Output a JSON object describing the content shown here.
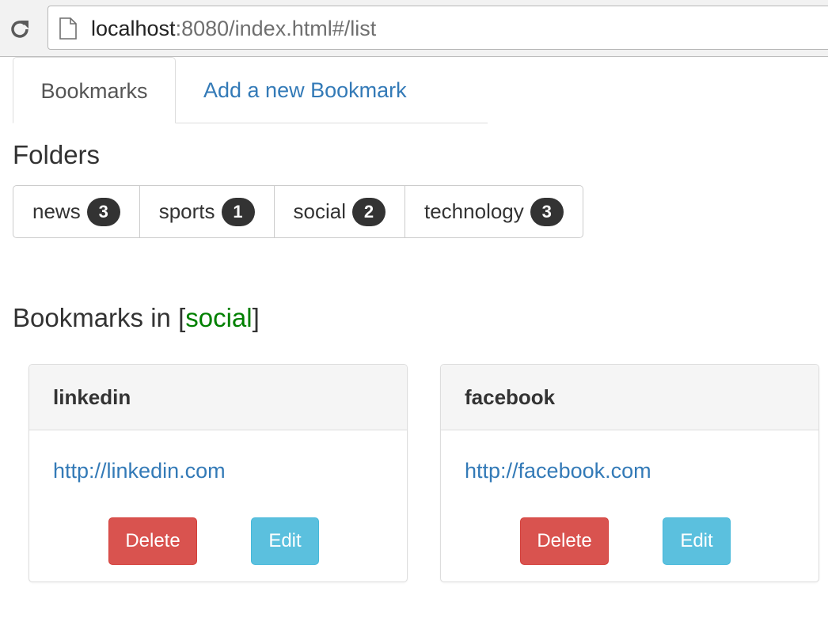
{
  "browser": {
    "url_host": "localhost",
    "url_rest": ":8080/index.html#/list"
  },
  "tabs": [
    {
      "label": "Bookmarks"
    },
    {
      "label": "Add a new Bookmark"
    }
  ],
  "folders": {
    "title": "Folders",
    "items": [
      {
        "name": "news",
        "count": "3"
      },
      {
        "name": "sports",
        "count": "1"
      },
      {
        "name": "social",
        "count": "2"
      },
      {
        "name": "technology",
        "count": "3"
      }
    ]
  },
  "bookmarks_section": {
    "title_prefix": "Bookmarks in [",
    "folder": "social",
    "title_suffix": "]",
    "items": [
      {
        "name": "linkedin",
        "url": "http://linkedin.com",
        "delete_label": "Delete",
        "edit_label": "Edit"
      },
      {
        "name": "facebook",
        "url": "http://facebook.com",
        "delete_label": "Delete",
        "edit_label": "Edit"
      }
    ]
  },
  "colors": {
    "link": "#337ab7",
    "folder_highlight": "#008000",
    "danger": "#d9534f",
    "info": "#5bc0de",
    "badge": "#333333"
  },
  "icons": [
    "reload-icon",
    "page-icon"
  ]
}
